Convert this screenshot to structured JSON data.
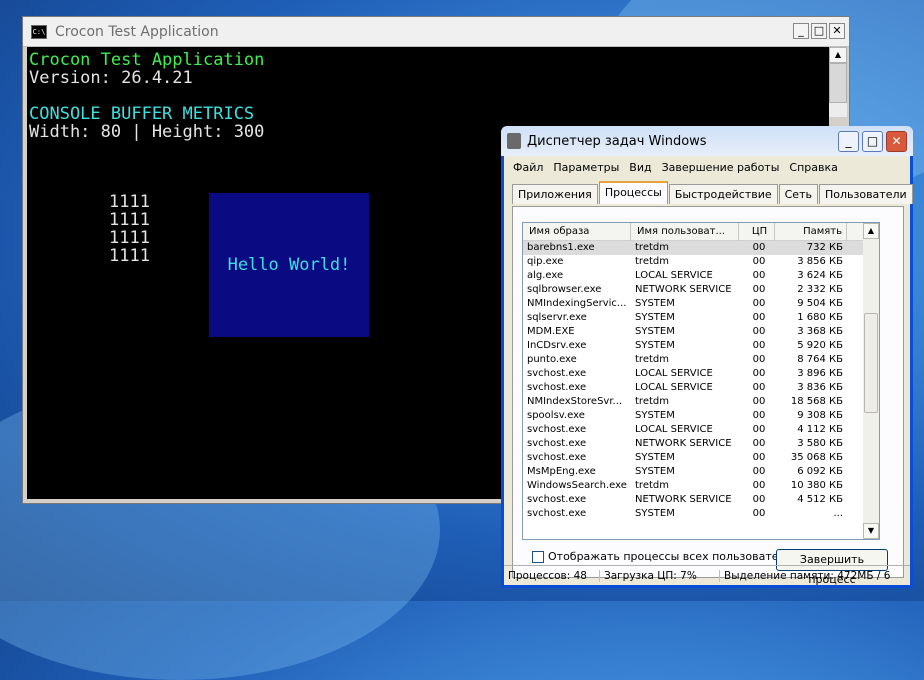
{
  "console": {
    "title": "Crocon Test Application",
    "icon_text": "C:\\",
    "controls": [
      "_",
      "□",
      "✕"
    ],
    "lines": [
      {
        "text": "Crocon Test Application",
        "color": "green"
      },
      {
        "text": "Version: 26.4.21",
        "color": "white"
      },
      {
        "text": "CONSOLE BUFFER METRICS",
        "color": "cyan"
      },
      {
        "text": "Width: 80 | Height: 300",
        "color": "white"
      }
    ],
    "pattern": [
      "1111",
      "1111",
      "1111",
      "1111"
    ],
    "hello": "Hello World!"
  },
  "taskmgr": {
    "title": "Диспетчер задач Windows",
    "controls": [
      "_",
      "□",
      "✕"
    ],
    "menu": [
      "Файл",
      "Параметры",
      "Вид",
      "Завершение работы",
      "Справка"
    ],
    "tabs": [
      "Приложения",
      "Процессы",
      "Быстродействие",
      "Сеть",
      "Пользователи"
    ],
    "columns": [
      "Имя образа",
      "Имя пользоват...",
      "ЦП",
      "Память"
    ],
    "rows": [
      [
        "barebns1.exe",
        "tretdm",
        "00",
        "732 КБ"
      ],
      [
        "qip.exe",
        "tretdm",
        "00",
        "3 856 КБ"
      ],
      [
        "alg.exe",
        "LOCAL SERVICE",
        "00",
        "3 624 КБ"
      ],
      [
        "sqlbrowser.exe",
        "NETWORK SERVICE",
        "00",
        "2 332 КБ"
      ],
      [
        "NMIndexingServic...",
        "SYSTEM",
        "00",
        "9 504 КБ"
      ],
      [
        "sqlservr.exe",
        "SYSTEM",
        "00",
        "1 680 КБ"
      ],
      [
        "MDM.EXE",
        "SYSTEM",
        "00",
        "3 368 КБ"
      ],
      [
        "InCDsrv.exe",
        "SYSTEM",
        "00",
        "5 920 КБ"
      ],
      [
        "punto.exe",
        "tretdm",
        "00",
        "8 764 КБ"
      ],
      [
        "svchost.exe",
        "LOCAL SERVICE",
        "00",
        "3 896 КБ"
      ],
      [
        "svchost.exe",
        "LOCAL SERVICE",
        "00",
        "3 836 КБ"
      ],
      [
        "NMIndexStoreSvr...",
        "tretdm",
        "00",
        "18 568 КБ"
      ],
      [
        "spoolsv.exe",
        "SYSTEM",
        "00",
        "9 308 КБ"
      ],
      [
        "svchost.exe",
        "LOCAL SERVICE",
        "00",
        "4 112 КБ"
      ],
      [
        "svchost.exe",
        "NETWORK SERVICE",
        "00",
        "3 580 КБ"
      ],
      [
        "svchost.exe",
        "SYSTEM",
        "00",
        "35 068 КБ"
      ],
      [
        "MsMpEng.exe",
        "SYSTEM",
        "00",
        "6 092 КБ"
      ],
      [
        "WindowsSearch.exe",
        "tretdm",
        "00",
        "10 380 КБ"
      ],
      [
        "svchost.exe",
        "NETWORK SERVICE",
        "00",
        "4 512 КБ"
      ],
      [
        "svchost.exe",
        "SYSTEM",
        "00",
        "..."
      ]
    ],
    "show_all_label": "Отображать процессы всех пользователей",
    "end_process": "Завершить процесс",
    "status": [
      "Процессов: 48",
      "Загрузка ЦП: 7%",
      "Выделение памяти: 472МБ / 6"
    ]
  }
}
